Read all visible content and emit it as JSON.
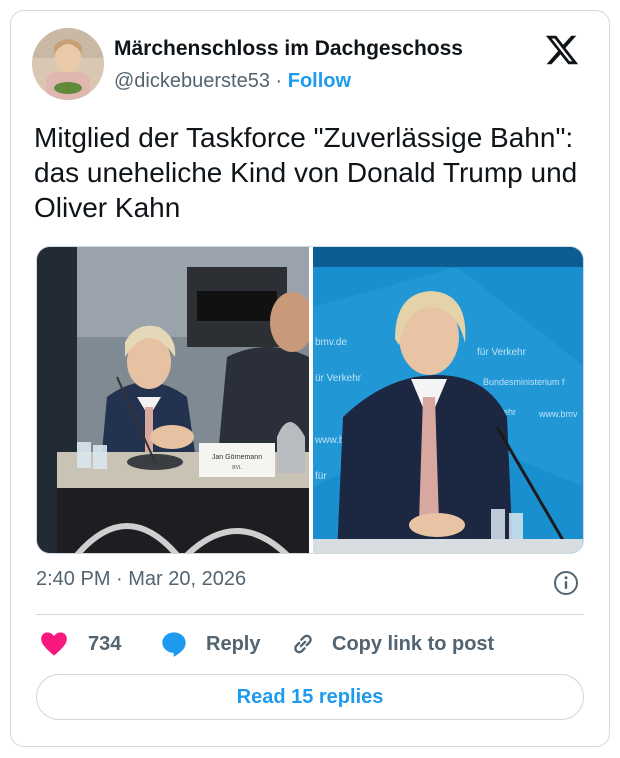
{
  "author": {
    "name": "Märchenschloss im Dachgeschoss",
    "handle": "@dickebuerste53",
    "separator": "·",
    "follow_label": "Follow"
  },
  "tweet": {
    "text": "Mitglied der Taskforce \"Zuverlässige Bahn\": das uneheliche Kind von Donald Trump und Oliver Kahn"
  },
  "media": {
    "left_photo": {
      "nameplate_name": "Jan Görnemann",
      "nameplate_sub": "BVL"
    },
    "right_photo": {
      "backdrop_texts": [
        "bmv.de",
        "für Verkehr",
        "Bundesministerium f",
        "Verkehr",
        "www.bmv",
        "ür Verkehr",
        "www.b",
        "für"
      ]
    }
  },
  "meta": {
    "timestamp": "2:40 PM · Mar 20, 2026"
  },
  "actions": {
    "like_count": "734",
    "reply_label": "Reply",
    "copy_label": "Copy link to post"
  },
  "read_replies_label": "Read 15 replies",
  "colors": {
    "accent": "#1d9bf0",
    "like": "#f91880",
    "text_primary": "#0f1419",
    "text_secondary": "#536471",
    "border": "#cfd9de"
  },
  "icons": [
    "x-logo-icon",
    "heart-icon",
    "reply-bubble-icon",
    "link-icon",
    "info-icon"
  ]
}
